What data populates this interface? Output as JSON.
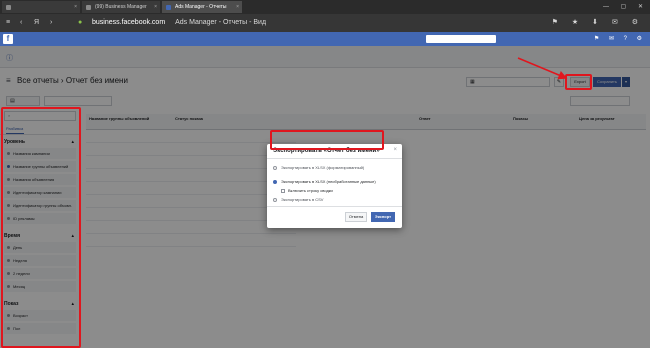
{
  "browser": {
    "tabs": [
      {
        "label": ""
      },
      {
        "label": "(99) Business Manager"
      },
      {
        "label": "Ads Manager - Отчеты"
      }
    ],
    "url_domain": "business.facebook.com",
    "page_title_suffix": "Ads Manager - Отчеты - Вид"
  },
  "fb_bar": {
    "menu_label": "",
    "search_placeholder": "",
    "user_name": ""
  },
  "notice": {
    "text": "",
    "help_text": ""
  },
  "header": {
    "title": "Все отчеты › Отчет без имени",
    "unsaved": "",
    "last_updated": "",
    "date_range": "",
    "export_label": "Export",
    "save_label": "Сохранить"
  },
  "toolbar": {
    "save_label": "",
    "search_placeholder": "",
    "filter_hint": "",
    "compare_label": ""
  },
  "sidebar": {
    "search_placeholder": "",
    "tabs": [
      "Разбивка",
      ""
    ],
    "section_level": "Уровень",
    "level_items": [
      "Названия кампании",
      "Название группы объявлений",
      "Названия объявления",
      "Идентификатор кампании",
      "Идентификатор группы объявл.",
      "ID рекламы"
    ],
    "section_time": "Время",
    "time_items": [
      "День",
      "Неделя",
      "2 недели",
      "Месяц"
    ],
    "section_delivery": "Показ",
    "delivery_items": [
      "Возраст",
      "Пол"
    ]
  },
  "table": {
    "columns": [
      "Название группы объявлений",
      "Статус показа",
      "",
      "",
      "Ответ",
      "",
      "Показы",
      "Цена за результат"
    ],
    "rows": [
      {
        "name": "",
        "status": "",
        "sub": ""
      },
      {
        "name": "",
        "status": "",
        "sub": ""
      },
      {
        "name": "",
        "status": "",
        "sub": ""
      },
      {
        "name": "",
        "status": "",
        "sub": ""
      },
      {
        "name": "",
        "status": "",
        "sub": ""
      },
      {
        "name": "",
        "status": "",
        "sub": ""
      },
      {
        "name": "",
        "status": "",
        "sub": ""
      },
      {
        "name": "",
        "status": "",
        "sub": ""
      },
      {
        "name": "",
        "status": "",
        "sub": ""
      }
    ],
    "cell_fill": "",
    "total_label": "",
    "total_sub": ""
  },
  "modal": {
    "title": "Экспортировать «Отчет без имени»",
    "options": [
      "Экспортировать в XLSX (форматированный)",
      "Экспортировать в XLSX (необработанные данные)",
      "Экспортировать в CSV"
    ],
    "selected_option": 1,
    "include_summary": "Включить строку сводки",
    "cancel_label": "Отмена",
    "export_label": "Экспорт"
  },
  "colors": {
    "fb_blue": "#4267b2",
    "highlight_red": "#e0161e",
    "overlay": "rgba(0,0,0,0.45)"
  }
}
